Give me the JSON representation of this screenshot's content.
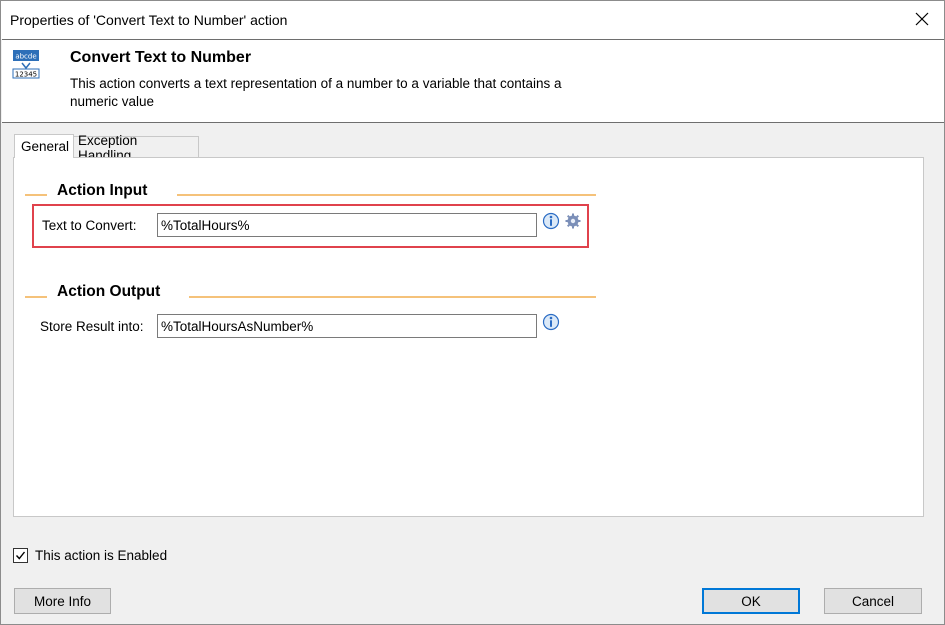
{
  "window": {
    "title": "Properties of 'Convert Text to Number' action"
  },
  "header": {
    "title": "Convert Text to Number",
    "description": "This action converts a text representation of a number to a variable that contains a numeric value",
    "icon_text_top": "abcde",
    "icon_text_bottom": "12345"
  },
  "tabs": [
    {
      "label": "General",
      "selected": true
    },
    {
      "label": "Exception Handling",
      "selected": false
    }
  ],
  "action_input": {
    "section_title": "Action Input",
    "text_to_convert_label": "Text to Convert:",
    "text_to_convert_value": "%TotalHours%"
  },
  "action_output": {
    "section_title": "Action Output",
    "store_result_label": "Store Result into:",
    "store_result_value": "%TotalHoursAsNumber%"
  },
  "footer": {
    "enabled_label": "This action is Enabled",
    "enabled_checked": true,
    "more_info_label": "More Info",
    "ok_label": "OK",
    "cancel_label": "Cancel"
  },
  "colors": {
    "section_line": "#f5c27a",
    "highlight": "#e0424c",
    "ok_border": "#0078d7"
  }
}
